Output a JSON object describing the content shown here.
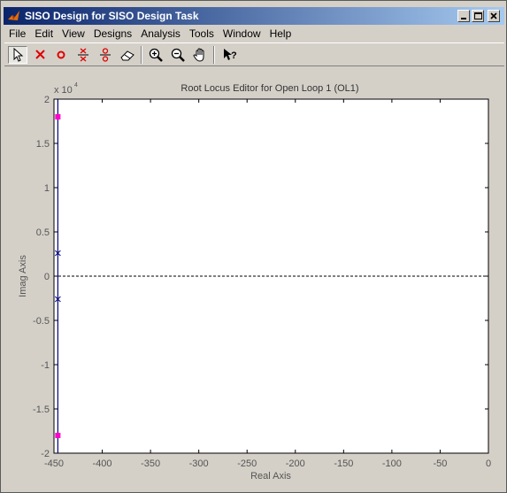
{
  "window": {
    "title": "SISO Design for SISO Design Task"
  },
  "menu": [
    "File",
    "Edit",
    "View",
    "Designs",
    "Analysis",
    "Tools",
    "Window",
    "Help"
  ],
  "toolbar": {
    "tools": [
      {
        "name": "select-tool",
        "icon": "arrow-pointer-icon"
      },
      {
        "name": "add-real-pole-tool",
        "icon": "pole-x-icon"
      },
      {
        "name": "add-real-zero-tool",
        "icon": "zero-o-icon"
      },
      {
        "name": "add-complex-pole-tool",
        "icon": "complex-pole-icon"
      },
      {
        "name": "add-complex-zero-tool",
        "icon": "complex-zero-icon"
      },
      {
        "name": "erase-tool",
        "icon": "eraser-icon"
      },
      {
        "name": "zoom-in-tool",
        "icon": "zoom-in-icon"
      },
      {
        "name": "zoom-out-tool",
        "icon": "zoom-out-icon"
      },
      {
        "name": "pan-tool",
        "icon": "hand-icon"
      },
      {
        "name": "whats-this-tool",
        "icon": "help-arrow-icon"
      }
    ]
  },
  "chart_data": {
    "type": "scatter",
    "title": "Root Locus Editor for Open Loop 1 (OL1)",
    "xlabel": "Real Axis",
    "ylabel": "Imag Axis",
    "y_exponent_label": "x 10",
    "y_exponent_power": "4",
    "xlim": [
      -450,
      0
    ],
    "ylim": [
      -2,
      2
    ],
    "xticks": [
      "-450",
      "-400",
      "-350",
      "-300",
      "-250",
      "-200",
      "-150",
      "-100",
      "-50",
      "0"
    ],
    "yticks": [
      "2",
      "1.5",
      "1",
      "0.5",
      "0",
      "-0.5",
      "-1",
      "-1.5",
      "-2"
    ],
    "grid": false,
    "zero_line": "dashed",
    "series": [
      {
        "kind": "poles",
        "marker": "x",
        "color": "#00007f",
        "points": [
          {
            "x": -446,
            "y": 0.26
          },
          {
            "x": -446,
            "y": -0.26
          }
        ]
      },
      {
        "kind": "closed-loop-poles",
        "marker": "square",
        "color": "#ff00cc",
        "points": [
          {
            "x": -446,
            "y": 1.8
          },
          {
            "x": -446,
            "y": -1.8
          }
        ]
      },
      {
        "kind": "locus",
        "marker": "line",
        "color": "#00007f",
        "points": [
          {
            "x": -446,
            "y": 2
          },
          {
            "x": -446,
            "y": -2
          }
        ]
      }
    ]
  }
}
